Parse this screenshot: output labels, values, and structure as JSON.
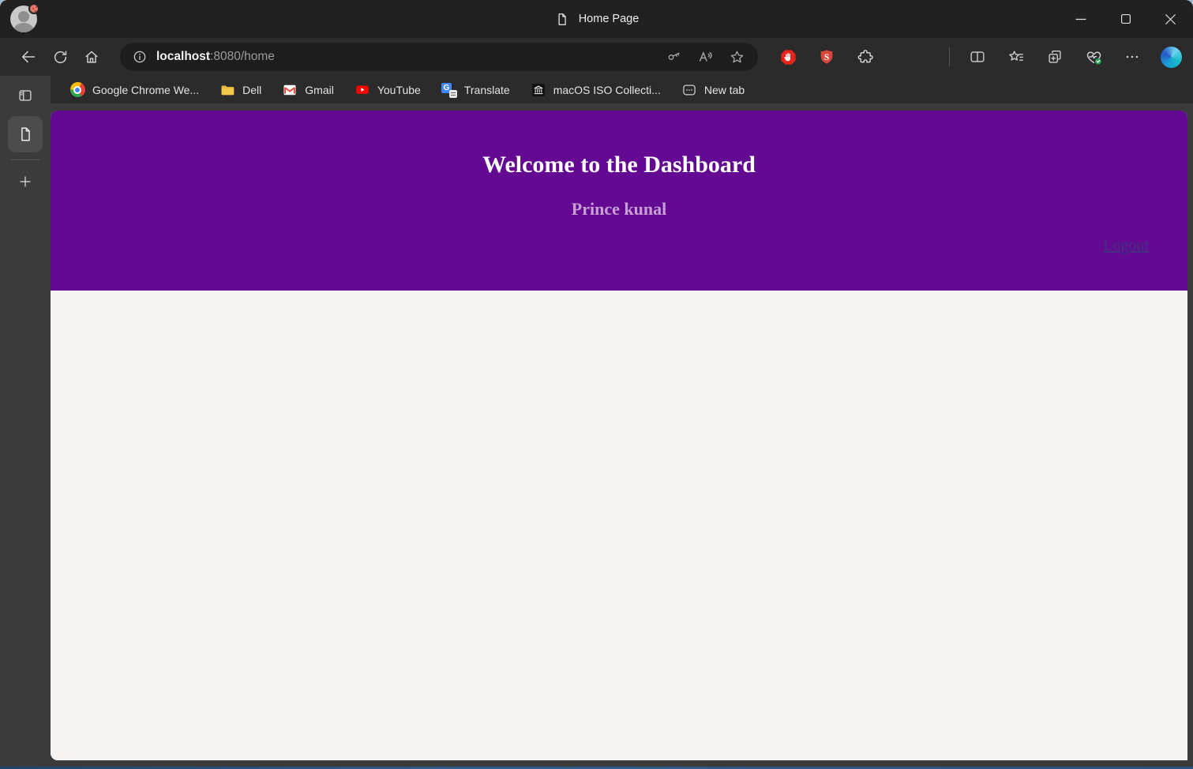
{
  "titlebar": {
    "tab_title": "Home Page"
  },
  "toolbar": {
    "url_host": "localhost",
    "url_rest": ":8080/home"
  },
  "bookmarks": [
    {
      "label": "Google Chrome We...",
      "icon": "chrome-favicon"
    },
    {
      "label": "Dell",
      "icon": "folder-icon"
    },
    {
      "label": "Gmail",
      "icon": "gmail-favicon"
    },
    {
      "label": "YouTube",
      "icon": "youtube-favicon"
    },
    {
      "label": "Translate",
      "icon": "translate-favicon"
    },
    {
      "label": "macOS ISO Collecti...",
      "icon": "bank-favicon"
    },
    {
      "label": "New tab",
      "icon": "newtab-favicon"
    }
  ],
  "translate_glyph": "G",
  "page": {
    "heading": "Welcome to the Dashboard",
    "subheading": "Prince kunal",
    "logout_label": "Logout",
    "colors": {
      "header_background": "#640a92",
      "heading_text": "#ffffff",
      "subheading_text": "#c9a0d4",
      "logout_link": "#433081",
      "page_background": "#f5f4f2"
    }
  },
  "icons": {
    "back": "left-arrow",
    "refresh": "circular-arrow",
    "home": "house",
    "site-info": "info-circle",
    "password": "key",
    "read-aloud": "A-with-soundwaves",
    "favorite-this-page": "star-outline",
    "adblock-extension": "red-octagon-white-hand",
    "shield-s-extension": "red-shield-S",
    "extensions": "puzzle-piece",
    "split-screen": "two-panes",
    "favorites": "star-with-list-lines",
    "collections": "stacked-panels-plus",
    "browser-essentials": "heart-pulse-check",
    "more-options": "three-dots",
    "copilot": "blue-swirl-circle",
    "minimize": "dash",
    "maximize": "square-outline",
    "close": "x",
    "tab-actions": "panel-left-filled",
    "page-document": "document-with-folded-corner",
    "new-tab": "plus"
  }
}
